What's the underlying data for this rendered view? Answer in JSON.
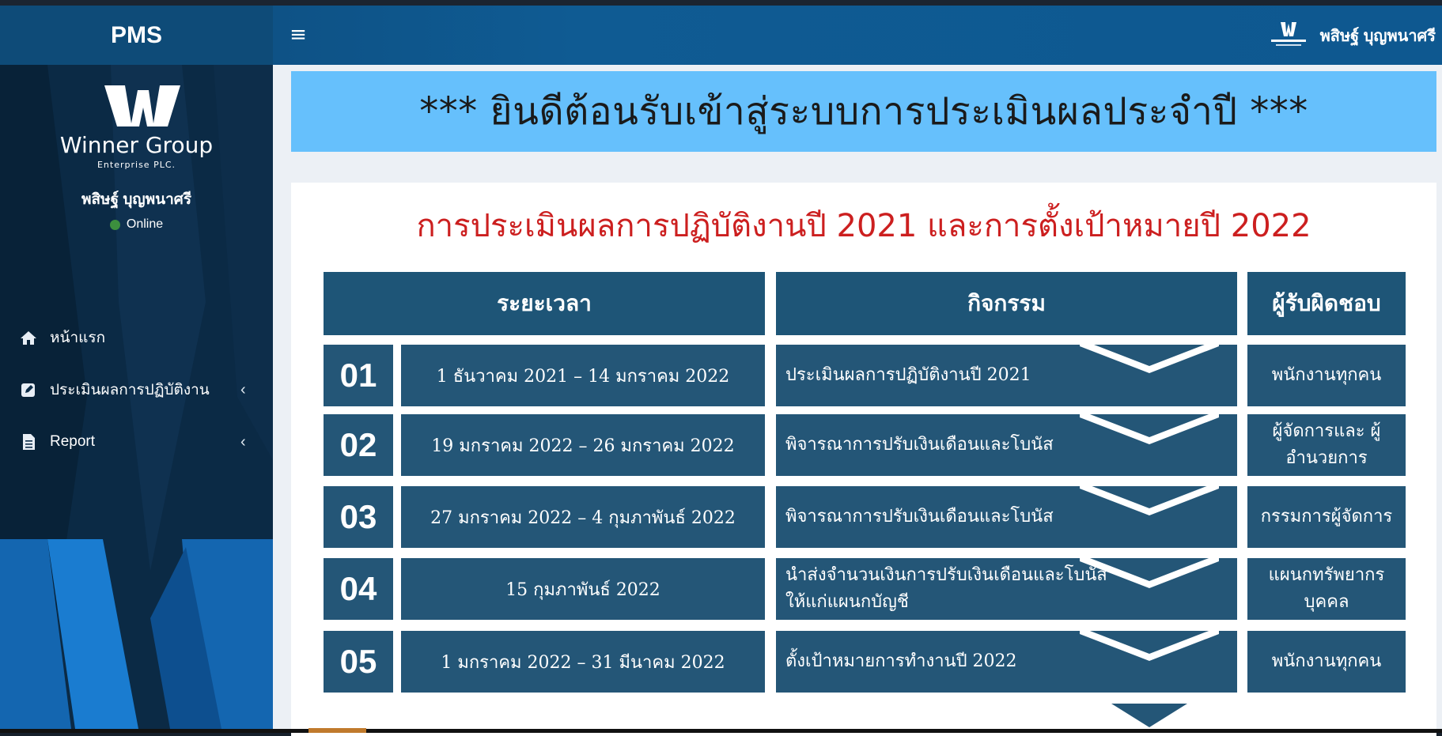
{
  "app": {
    "brand": "PMS"
  },
  "header": {
    "menu_icon": "bars-icon",
    "username": "พสิษฐ์ บุญพนาศรี"
  },
  "sidebar": {
    "logo_text": "Winner Group",
    "logo_subtext": "Enterprise PLC.",
    "username": "พสิษฐ์ บุญพนาศรี",
    "status": "Online",
    "status_color": "#3c8f3e",
    "items": [
      {
        "label": "หน้าแรก",
        "icon": "home-icon"
      },
      {
        "label": "ประเมินผลการปฏิบัติงาน",
        "icon": "edit-icon",
        "chevron": "‹"
      },
      {
        "label": "Report",
        "icon": "file-icon",
        "chevron": "‹"
      }
    ]
  },
  "main": {
    "welcome": "*** ยินดีต้อนรับเข้าสู่ระบบการประเมินผลประจำปี ***",
    "title": "การประเมินผลการปฏิบัติงานปี 2021 และการตั้งเป้าหมายปี 2022",
    "columns": [
      "ระยะเวลา",
      "กิจกรรม",
      "ผู้รับผิดชอบ"
    ],
    "rows": [
      {
        "num": "01",
        "period": "1 ธันวาคม 2021 – 14 มกราคม 2022",
        "activity": "ประเมินผลการปฏิบัติงานปี 2021",
        "owner": "พนักงานทุกคน"
      },
      {
        "num": "02",
        "period": "19 มกราคม 2022 – 26 มกราคม 2022",
        "activity": "พิจารณาการปรับเงินเดือนและโบนัส",
        "owner": "ผู้จัดการและ ผู้อำนวยการ"
      },
      {
        "num": "03",
        "period": "27 มกราคม 2022 – 4 กุมภาพันธ์ 2022",
        "activity": "พิจารณาการปรับเงินเดือนและโบนัส",
        "owner": "กรรมการผู้จัดการ"
      },
      {
        "num": "04",
        "period": "15 กุมภาพันธ์ 2022",
        "activity": "นำส่งจำนวนเงินการปรับเงินเดือนและโบนัส ให้แก่แผนกบัญชี",
        "owner": "แผนกทรัพยากร บุคคล"
      },
      {
        "num": "05",
        "period": "1 มกราคม 2022 – 31 มีนาคม 2022",
        "activity": "ตั้งเป้าหมายการทำงานปี 2022",
        "owner": "พนักงานทุกคน"
      }
    ]
  },
  "colors": {
    "welcome_bg": "#66c0fc",
    "title_red": "#cc1f1f",
    "table_blue": "#245677"
  }
}
